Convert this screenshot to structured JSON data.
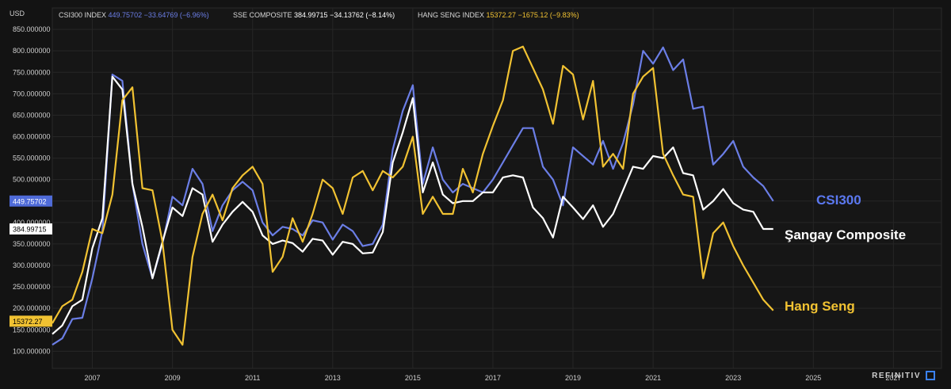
{
  "chart_data": {
    "type": "line",
    "currency": "USD",
    "x_ticks": [
      "2007",
      "2009",
      "2011",
      "2013",
      "2015",
      "2017",
      "2019",
      "2021",
      "2023",
      "2025",
      "2027"
    ],
    "y_ticks": [
      "100.000000",
      "150.000000",
      "200.000000",
      "250.000000",
      "300.000000",
      "350.000000",
      "400.000000",
      "450.000000",
      "500.000000",
      "550.000000",
      "600.000000",
      "650.000000",
      "700.000000",
      "750.000000",
      "800.000000",
      "850.000000"
    ],
    "xlim": [
      2006.0,
      2028.2
    ],
    "ylim": [
      60,
      900
    ],
    "grid": true,
    "legend_position": "top-left",
    "legend": [
      {
        "name": "CSI300 INDEX",
        "value": "449.75702",
        "change": "−33.64769 (−6.96%)",
        "color": "#6b7ee6"
      },
      {
        "name": "SSE COMPOSITE",
        "value": "384.99715",
        "change": "−34.13762 (−8.14%)",
        "color": "#ffffff"
      },
      {
        "name": "HANG SENG INDEX",
        "value": "15372.27",
        "change": "−1675.12 (−9.83%)",
        "color": "#f1c232"
      }
    ],
    "price_tags": [
      {
        "value": "449.75702",
        "y": 450,
        "bg": "#4f6bd8",
        "fg": "#ffffff"
      },
      {
        "value": "384.99715",
        "y": 385,
        "bg": "#ffffff",
        "fg": "#000000"
      },
      {
        "value": "15372.27",
        "y": 170,
        "bg": "#f1c232",
        "fg": "#000000"
      }
    ],
    "annotations": [
      {
        "text": "CSI300",
        "color": "#5b78f0"
      },
      {
        "text": "Şangay Composite",
        "color": "#ffffff"
      },
      {
        "text": "Hang Seng",
        "color": "#f1c232"
      }
    ],
    "series": [
      {
        "name": "CSI300",
        "color": "#6b7ee6",
        "x": [
          2006.0,
          2006.25,
          2006.5,
          2006.75,
          2007.0,
          2007.25,
          2007.5,
          2007.75,
          2008.0,
          2008.25,
          2008.5,
          2008.75,
          2009.0,
          2009.25,
          2009.5,
          2009.75,
          2010.0,
          2010.25,
          2010.5,
          2010.75,
          2011.0,
          2011.25,
          2011.5,
          2011.75,
          2012.0,
          2012.25,
          2012.5,
          2012.75,
          2013.0,
          2013.25,
          2013.5,
          2013.75,
          2014.0,
          2014.25,
          2014.5,
          2014.75,
          2015.0,
          2015.25,
          2015.5,
          2015.75,
          2016.0,
          2016.25,
          2016.5,
          2016.75,
          2017.0,
          2017.25,
          2017.5,
          2017.75,
          2018.0,
          2018.25,
          2018.5,
          2018.75,
          2019.0,
          2019.25,
          2019.5,
          2019.75,
          2020.0,
          2020.25,
          2020.5,
          2020.75,
          2021.0,
          2021.25,
          2021.5,
          2021.75,
          2022.0,
          2022.25,
          2022.5,
          2022.75,
          2023.0,
          2023.25,
          2023.5,
          2023.75,
          2024.0
        ],
        "values": [
          115,
          130,
          175,
          178,
          270,
          380,
          745,
          730,
          490,
          350,
          270,
          350,
          460,
          440,
          525,
          490,
          380,
          440,
          475,
          495,
          475,
          400,
          370,
          390,
          385,
          370,
          405,
          400,
          360,
          395,
          380,
          345,
          350,
          395,
          570,
          660,
          720,
          490,
          575,
          500,
          470,
          490,
          480,
          470,
          500,
          540,
          580,
          620,
          620,
          530,
          500,
          440,
          575,
          555,
          535,
          590,
          525,
          585,
          675,
          800,
          770,
          808,
          755,
          780,
          665,
          670,
          535,
          560,
          590,
          530,
          505,
          485,
          450
        ]
      },
      {
        "name": "Şangay Composite",
        "color": "#ffffff",
        "x": [
          2006.0,
          2006.25,
          2006.5,
          2006.75,
          2007.0,
          2007.25,
          2007.5,
          2007.75,
          2008.0,
          2008.25,
          2008.5,
          2008.75,
          2009.0,
          2009.25,
          2009.5,
          2009.75,
          2010.0,
          2010.25,
          2010.5,
          2010.75,
          2011.0,
          2011.25,
          2011.5,
          2011.75,
          2012.0,
          2012.25,
          2012.5,
          2012.75,
          2013.0,
          2013.25,
          2013.5,
          2013.75,
          2014.0,
          2014.25,
          2014.5,
          2014.75,
          2015.0,
          2015.25,
          2015.5,
          2015.75,
          2016.0,
          2016.25,
          2016.5,
          2016.75,
          2017.0,
          2017.25,
          2017.5,
          2017.75,
          2018.0,
          2018.25,
          2018.5,
          2018.75,
          2019.0,
          2019.25,
          2019.5,
          2019.75,
          2020.0,
          2020.25,
          2020.5,
          2020.75,
          2021.0,
          2021.25,
          2021.5,
          2021.75,
          2022.0,
          2022.25,
          2022.5,
          2022.75,
          2023.0,
          2023.25,
          2023.5,
          2023.75,
          2024.0
        ],
        "values": [
          140,
          160,
          205,
          220,
          340,
          410,
          740,
          710,
          490,
          390,
          270,
          355,
          435,
          415,
          480,
          465,
          355,
          395,
          425,
          448,
          425,
          370,
          350,
          358,
          352,
          332,
          362,
          358,
          325,
          355,
          350,
          328,
          330,
          378,
          540,
          610,
          690,
          470,
          540,
          465,
          445,
          450,
          450,
          470,
          470,
          505,
          510,
          505,
          435,
          410,
          365,
          460,
          435,
          408,
          440,
          390,
          420,
          475,
          530,
          525,
          555,
          550,
          575,
          515,
          510,
          430,
          450,
          478,
          445,
          430,
          425,
          385,
          385
        ]
      },
      {
        "name": "Hang Seng",
        "color": "#f1c232",
        "x": [
          2006.0,
          2006.25,
          2006.5,
          2006.75,
          2007.0,
          2007.25,
          2007.5,
          2007.75,
          2008.0,
          2008.25,
          2008.5,
          2008.75,
          2009.0,
          2009.25,
          2009.5,
          2009.75,
          2010.0,
          2010.25,
          2010.5,
          2010.75,
          2011.0,
          2011.25,
          2011.5,
          2011.75,
          2012.0,
          2012.25,
          2012.5,
          2012.75,
          2013.0,
          2013.25,
          2013.5,
          2013.75,
          2014.0,
          2014.25,
          2014.5,
          2014.75,
          2015.0,
          2015.25,
          2015.5,
          2015.75,
          2016.0,
          2016.25,
          2016.5,
          2016.75,
          2017.0,
          2017.25,
          2017.5,
          2017.75,
          2018.0,
          2018.25,
          2018.5,
          2018.75,
          2019.0,
          2019.25,
          2019.5,
          2019.75,
          2020.0,
          2020.25,
          2020.5,
          2020.75,
          2021.0,
          2021.25,
          2021.5,
          2021.75,
          2022.0,
          2022.25,
          2022.5,
          2022.75,
          2023.0,
          2023.25,
          2023.5,
          2023.75,
          2024.0
        ],
        "values": [
          165,
          205,
          220,
          285,
          385,
          375,
          465,
          685,
          715,
          480,
          475,
          355,
          150,
          115,
          320,
          420,
          465,
          405,
          480,
          510,
          530,
          490,
          285,
          320,
          410,
          355,
          420,
          500,
          480,
          420,
          505,
          520,
          475,
          520,
          505,
          530,
          600,
          420,
          460,
          420,
          420,
          525,
          470,
          560,
          625,
          685,
          800,
          810,
          760,
          710,
          630,
          765,
          745,
          640,
          730,
          530,
          560,
          525,
          700,
          740,
          760,
          560,
          510,
          465,
          460,
          270,
          375,
          400,
          345,
          300,
          260,
          220,
          195
        ]
      }
    ]
  }
}
